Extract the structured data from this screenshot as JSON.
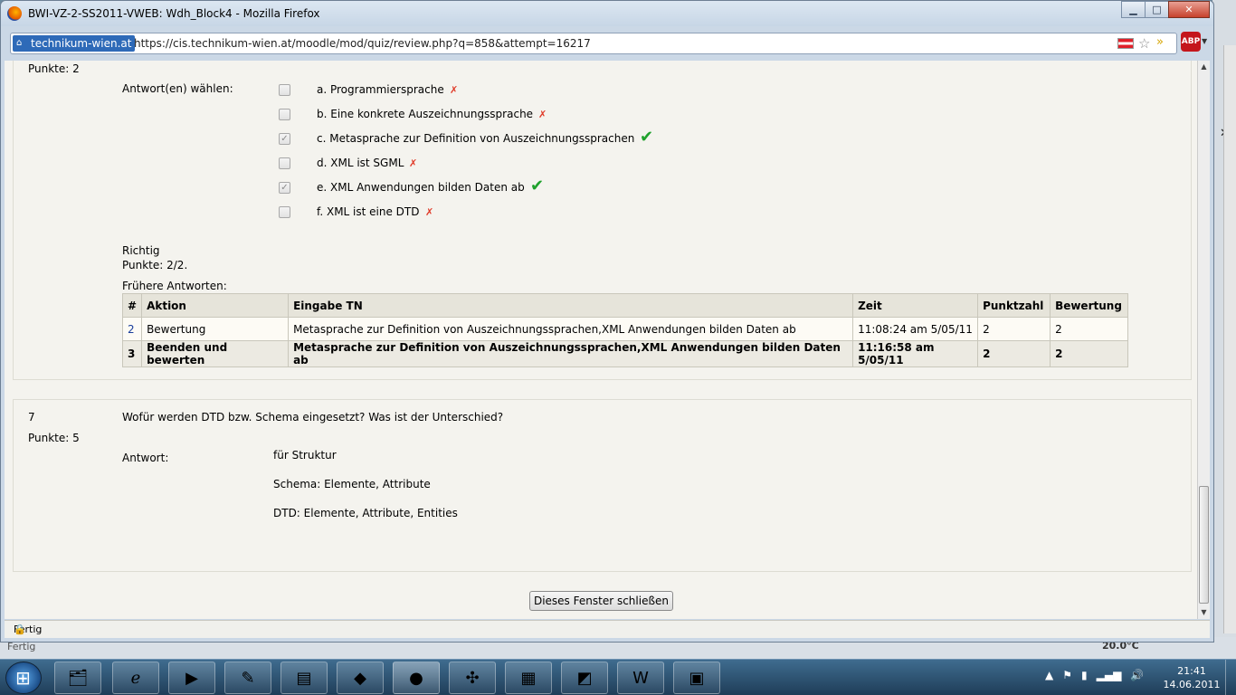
{
  "window": {
    "title": "BWI-VZ-2-SS2011-VWEB: Wdh_Block4 - Mozilla Firefox",
    "controls": {
      "minimize": "▁",
      "maximize": "□",
      "close": "✕"
    }
  },
  "addressbar": {
    "site_identity": "technikum-wien.at",
    "url": "https://cis.technikum-wien.at/moodle/mod/quiz/review.php?q=858&attempt=16217"
  },
  "question6": {
    "points_label": "Punkte: 2",
    "answers_label": "Antwort(en) wählen:",
    "options": [
      {
        "text": "a. Programmiersprache",
        "checked": false,
        "mark": "✗"
      },
      {
        "text": "b. Eine konkrete Auszeichnungssprache",
        "checked": false,
        "mark": "✗"
      },
      {
        "text": "c. Metasprache zur Definition von Auszeichnungssprachen",
        "checked": true,
        "mark": "✔"
      },
      {
        "text": "d. XML ist SGML",
        "checked": false,
        "mark": "✗"
      },
      {
        "text": "e. XML Anwendungen bilden Daten ab",
        "checked": true,
        "mark": "✔"
      },
      {
        "text": "f. XML ist eine DTD",
        "checked": false,
        "mark": "✗"
      }
    ],
    "result": "Richtig",
    "score": "Punkte: 2/2.",
    "history_label": "Frühere Antworten:",
    "history": {
      "headers": [
        "#",
        "Aktion",
        "Eingabe TN",
        "Zeit",
        "Punktzahl",
        "Bewertung"
      ],
      "rows": [
        [
          "2",
          "Bewertung",
          "Metasprache zur Definition von Auszeichnungssprachen,XML Anwendungen bilden Daten ab",
          "11:08:24 am 5/05/11",
          "2",
          "2"
        ],
        [
          "3",
          "Beenden und bewerten",
          "Metasprache zur Definition von Auszeichnungssprachen,XML Anwendungen bilden Daten ab",
          "11:16:58 am 5/05/11",
          "2",
          "2"
        ]
      ]
    }
  },
  "question7": {
    "number": "7",
    "points_label": "Punkte: 5",
    "question": "Wofür werden DTD bzw. Schema eingesetzt? Was ist der Unterschied?",
    "answer_label": "Antwort:",
    "answer_lines": [
      "für Struktur",
      "Schema: Elemente, Attribute",
      "DTD: Elemente, Attribute, Entities"
    ]
  },
  "close_button": "Dieses Fenster schließen",
  "statusbar": {
    "text": "Fertig"
  },
  "background": {
    "status_text": "Fertig",
    "temperature": "20.0°C"
  },
  "taskbar": {
    "clock_time": "21:41",
    "clock_date": "14.06.2011"
  },
  "colors": {
    "wrong": "#e03a28",
    "right": "#1fa12c",
    "link": "#1a3e9c"
  }
}
